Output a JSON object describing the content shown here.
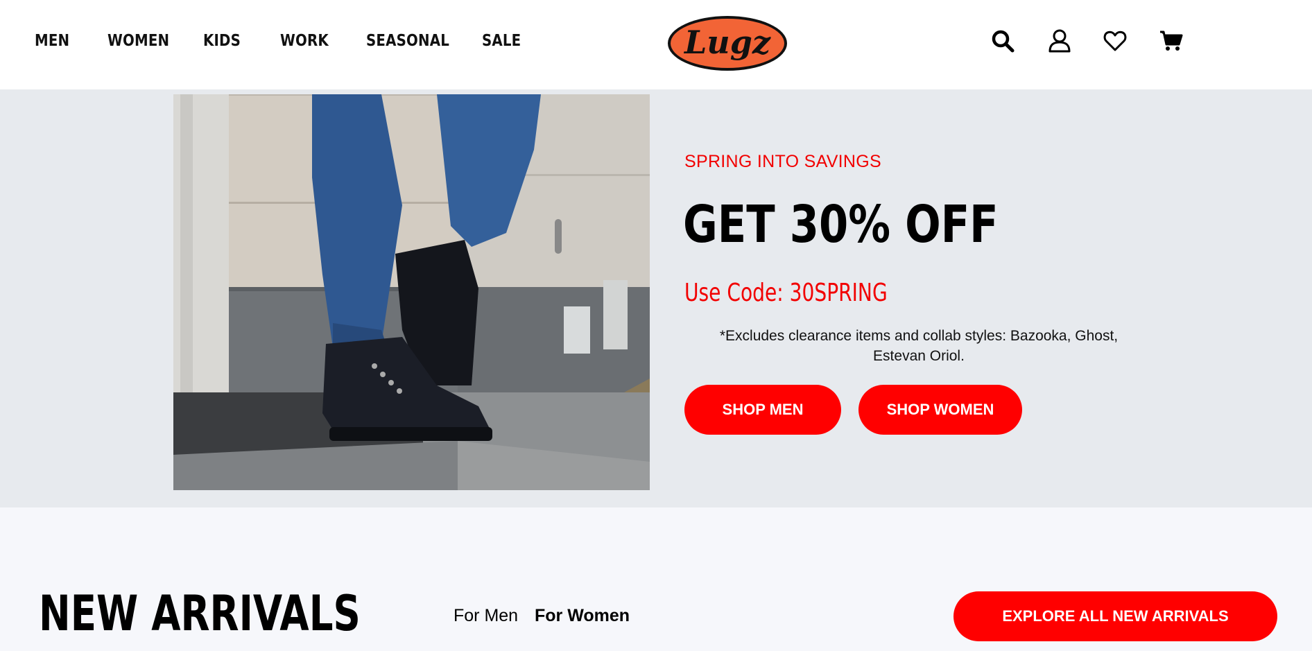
{
  "nav": {
    "items": [
      {
        "label": "MEN"
      },
      {
        "label": "WOMEN"
      },
      {
        "label": "KIDS"
      },
      {
        "label": "WORK"
      },
      {
        "label": "SEASONAL"
      },
      {
        "label": "SALE"
      }
    ]
  },
  "brand": {
    "logo_text": "Lugz",
    "logo_color": "#f26436"
  },
  "header_icons": [
    "search-icon",
    "account-icon",
    "wishlist-heart-icon",
    "cart-icon"
  ],
  "hero": {
    "kicker": "SPRING INTO SAVINGS",
    "headline": "GET 30% OFF",
    "code": "Use Code: 30SPRING",
    "note": "*Excludes clearance items and collab styles: Bazooka, Ghost, Estevan Oriol.",
    "shop_men": "SHOP MEN",
    "shop_women": "SHOP WOMEN"
  },
  "new_arrivals": {
    "title": "NEW ARRIVALS",
    "tabs": [
      {
        "label": "For Men",
        "active": false
      },
      {
        "label": "For Women",
        "active": true
      }
    ],
    "explore": "EXPLORE ALL NEW ARRIVALS"
  },
  "colors": {
    "accent_red": "#ff0000",
    "hero_bg": "#e7eaee",
    "page_bg": "#f6f7fb"
  }
}
